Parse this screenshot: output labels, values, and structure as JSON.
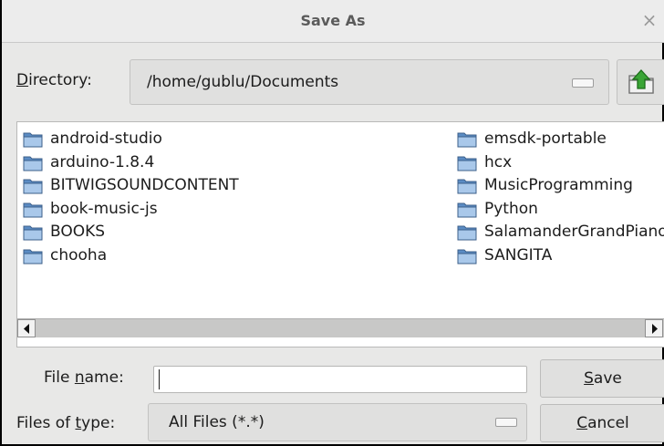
{
  "window": {
    "title": "Save As",
    "close_glyph": "×"
  },
  "directory": {
    "label_prefix": "D",
    "label_rest": "irectory:",
    "path": "/home/gublu/Documents",
    "up_button_icon": "folder-up-icon"
  },
  "folders": {
    "left": [
      "android-studio",
      "arduino-1.8.4",
      "BITWIGSOUNDCONTENT",
      "book-music-js",
      "BOOKS",
      "chooha"
    ],
    "right": [
      "emsdk-portable",
      "hcx",
      "MusicProgramming",
      "Python",
      "SalamanderGrandPiano",
      "SANGITA"
    ]
  },
  "filename": {
    "label_before": "File ",
    "label_mnemonic": "n",
    "label_after": "ame:",
    "value": ""
  },
  "filetype": {
    "label_before": "Files of ",
    "label_mnemonic": "t",
    "label_after": "ype:",
    "selected": "All Files (*.*)"
  },
  "buttons": {
    "save_mnemonic": "S",
    "save_rest": "ave",
    "cancel_mnemonic": "C",
    "cancel_rest": "ancel"
  },
  "colors": {
    "folder_fill": "#5b8cc4",
    "folder_light": "#a9c8ea",
    "up_arrow": "#3aa536"
  }
}
